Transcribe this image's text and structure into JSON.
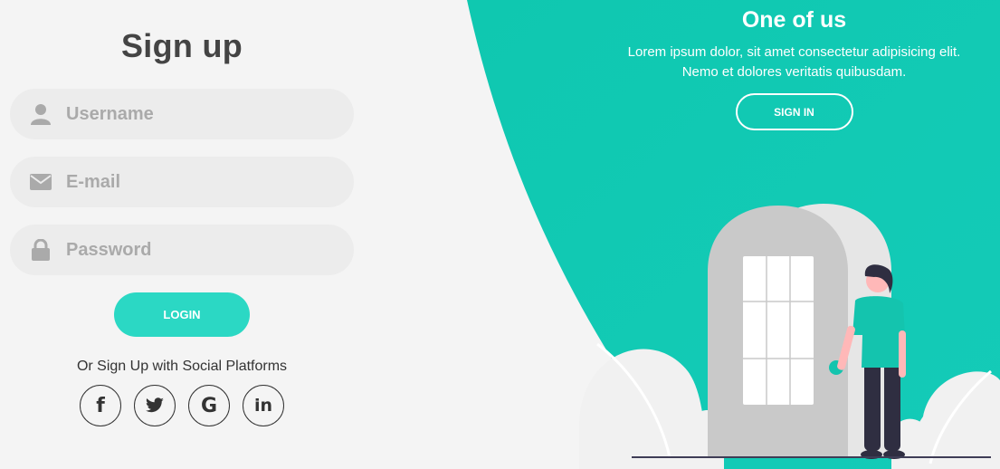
{
  "signup": {
    "title": "Sign up",
    "username_placeholder": "Username",
    "email_placeholder": "E-mail",
    "password_placeholder": "Password",
    "login_label": "LOGIN",
    "social_text": "Or Sign Up with Social Platforms",
    "social": [
      {
        "icon": "facebook-icon",
        "glyph": "f"
      },
      {
        "icon": "twitter-icon",
        "glyph": ""
      },
      {
        "icon": "google-icon",
        "glyph": "G"
      },
      {
        "icon": "linkedin-icon",
        "glyph": "in"
      }
    ]
  },
  "panel": {
    "title": "One of us",
    "text_line1": "Lorem ipsum dolor, sit amet consectetur adipisicing elit.",
    "text_line2": "Nemo et dolores veritatis quibusdam.",
    "signin_label": "SIGN IN"
  },
  "colors": {
    "accent": "#11c9b2",
    "login_button": "#2bd8c4",
    "background": "#f4f4f4",
    "input_bg": "#ececec"
  }
}
